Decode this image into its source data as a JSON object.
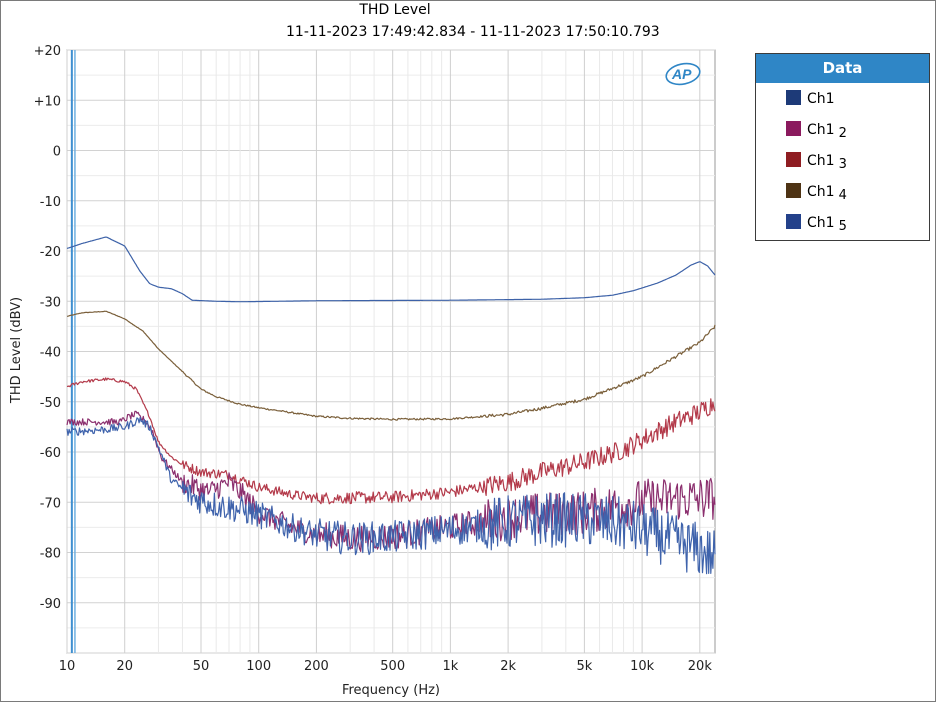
{
  "header": {
    "title": "THD Level",
    "time_range": "11-11-2023 17:49:42.834 - 11-11-2023 17:50:10.793"
  },
  "logo": {
    "text": "AP",
    "color": "#2f86c6"
  },
  "legend": {
    "title": "Data",
    "items": [
      {
        "label": "Ch1",
        "sub": "",
        "color": "#1d3a78"
      },
      {
        "label": "Ch1",
        "sub": "2",
        "color": "#8b1a5e"
      },
      {
        "label": "Ch1",
        "sub": "3",
        "color": "#8f1d22"
      },
      {
        "label": "Ch1",
        "sub": "4",
        "color": "#4e3314"
      },
      {
        "label": "Ch1",
        "sub": "5",
        "color": "#23418a"
      }
    ]
  },
  "chart_data": {
    "type": "line",
    "title": "THD Level",
    "xlabel": "Frequency (Hz)",
    "ylabel": "THD Level (dBV)",
    "xscale": "log",
    "xlim": [
      10,
      24000
    ],
    "ylim": [
      -100,
      20
    ],
    "grid": true,
    "legend_position": "right",
    "y_ticks": [
      "+20",
      "+10",
      "0",
      "-10",
      "-20",
      "-30",
      "-40",
      "-50",
      "-60",
      "-70",
      "-80",
      "-90"
    ],
    "y_tick_values": [
      20,
      10,
      0,
      -10,
      -20,
      -30,
      -40,
      -50,
      -60,
      -70,
      -80,
      -90
    ],
    "x_ticks": [
      "10",
      "20",
      "50",
      "100",
      "200",
      "500",
      "1k",
      "2k",
      "5k",
      "10k",
      "20k"
    ],
    "x_tick_values": [
      10,
      20,
      50,
      100,
      200,
      500,
      1000,
      2000,
      5000,
      10000,
      20000
    ],
    "series": [
      {
        "name": "Ch1 5",
        "color": "#3d62a8",
        "noise": 0,
        "points": [
          [
            10,
            -19.5
          ],
          [
            12,
            -18.5
          ],
          [
            16,
            -17.2
          ],
          [
            20,
            -19
          ],
          [
            24,
            -24
          ],
          [
            27,
            -26.5
          ],
          [
            30,
            -27.2
          ],
          [
            35,
            -27.5
          ],
          [
            40,
            -28.5
          ],
          [
            45,
            -29.8
          ],
          [
            60,
            -30
          ],
          [
            80,
            -30.1
          ],
          [
            200,
            -29.9
          ],
          [
            1000,
            -29.8
          ],
          [
            3000,
            -29.6
          ],
          [
            5000,
            -29.3
          ],
          [
            7000,
            -28.8
          ],
          [
            9000,
            -27.9
          ],
          [
            12000,
            -26.4
          ],
          [
            15000,
            -24.8
          ],
          [
            18000,
            -22.8
          ],
          [
            20000,
            -22.1
          ],
          [
            22000,
            -23
          ],
          [
            24000,
            -24.8
          ]
        ]
      },
      {
        "name": "Ch1 4",
        "color": "#7a5f3a",
        "noise": 0.3,
        "points": [
          [
            10,
            -33
          ],
          [
            12,
            -32.3
          ],
          [
            16,
            -32
          ],
          [
            20,
            -33.5
          ],
          [
            25,
            -36
          ],
          [
            30,
            -39.5
          ],
          [
            40,
            -44
          ],
          [
            50,
            -47.5
          ],
          [
            60,
            -49
          ],
          [
            80,
            -50.5
          ],
          [
            100,
            -51.2
          ],
          [
            150,
            -52.2
          ],
          [
            200,
            -52.9
          ],
          [
            300,
            -53.3
          ],
          [
            500,
            -53.5
          ],
          [
            1000,
            -53.4
          ],
          [
            2000,
            -52.5
          ],
          [
            3000,
            -51.3
          ],
          [
            5000,
            -49.5
          ],
          [
            8000,
            -46.5
          ],
          [
            10000,
            -45
          ],
          [
            15000,
            -41
          ],
          [
            20000,
            -38.2
          ],
          [
            24000,
            -35
          ]
        ]
      },
      {
        "name": "Ch1 3",
        "color": "#b33a4a",
        "noise": 2.0,
        "points": [
          [
            10,
            -47
          ],
          [
            12,
            -46
          ],
          [
            16,
            -45.5
          ],
          [
            20,
            -46
          ],
          [
            23,
            -47.5
          ],
          [
            27,
            -53
          ],
          [
            30,
            -58
          ],
          [
            35,
            -61
          ],
          [
            40,
            -62.5
          ],
          [
            50,
            -64
          ],
          [
            70,
            -64.5
          ],
          [
            100,
            -67
          ],
          [
            150,
            -68.5
          ],
          [
            200,
            -69.2
          ],
          [
            500,
            -69
          ],
          [
            1000,
            -68
          ],
          [
            2000,
            -66
          ],
          [
            3000,
            -64
          ],
          [
            5000,
            -62
          ],
          [
            8000,
            -59.5
          ],
          [
            10000,
            -57.5
          ],
          [
            15000,
            -54
          ],
          [
            20000,
            -52
          ],
          [
            24000,
            -50
          ]
        ]
      },
      {
        "name": "Ch1 2",
        "color": "#8b2f6e",
        "noise": 4.5,
        "points": [
          [
            10,
            -54
          ],
          [
            16,
            -54
          ],
          [
            19,
            -54
          ],
          [
            21,
            -53
          ],
          [
            23,
            -52.5
          ],
          [
            26,
            -54
          ],
          [
            28,
            -56
          ],
          [
            31,
            -61
          ],
          [
            40,
            -66
          ],
          [
            55,
            -68
          ],
          [
            70,
            -66
          ],
          [
            85,
            -69
          ],
          [
            100,
            -72
          ],
          [
            150,
            -75
          ],
          [
            200,
            -76.5
          ],
          [
            300,
            -77.2
          ],
          [
            500,
            -76.8
          ],
          [
            1000,
            -75
          ],
          [
            2000,
            -73
          ],
          [
            3000,
            -72.5
          ],
          [
            5000,
            -72
          ],
          [
            8000,
            -70.5
          ],
          [
            10000,
            -69.8
          ],
          [
            15000,
            -69.3
          ],
          [
            20000,
            -69.3
          ],
          [
            24000,
            -69
          ]
        ]
      },
      {
        "name": "Ch1",
        "color": "#3f63ac",
        "noise": 5.5,
        "points": [
          [
            10,
            -56
          ],
          [
            16,
            -55.5
          ],
          [
            20,
            -55
          ],
          [
            24,
            -53.5
          ],
          [
            27,
            -55
          ],
          [
            30,
            -59
          ],
          [
            35,
            -65.5
          ],
          [
            45,
            -69
          ],
          [
            60,
            -70.5
          ],
          [
            80,
            -71.5
          ],
          [
            100,
            -72.5
          ],
          [
            150,
            -75
          ],
          [
            200,
            -76.5
          ],
          [
            300,
            -77.2
          ],
          [
            500,
            -77
          ],
          [
            1000,
            -75.5
          ],
          [
            2000,
            -74
          ],
          [
            3000,
            -73.5
          ],
          [
            5000,
            -73.5
          ],
          [
            8000,
            -74.5
          ],
          [
            10000,
            -75.5
          ],
          [
            15000,
            -78
          ],
          [
            20000,
            -79.5
          ],
          [
            24000,
            -81
          ]
        ]
      }
    ]
  }
}
